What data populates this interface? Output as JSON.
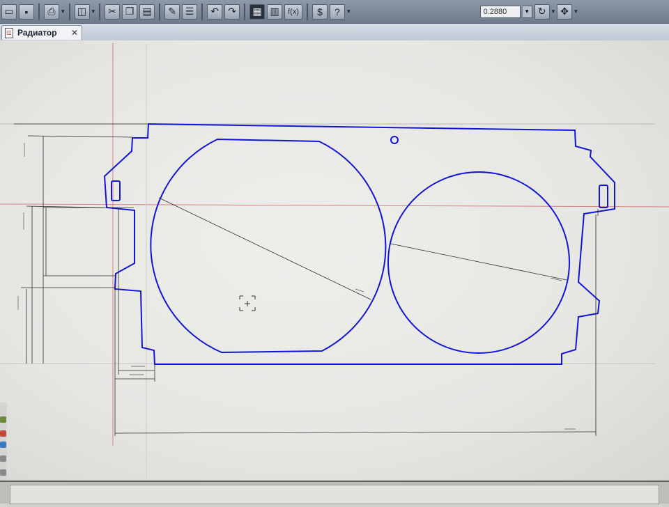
{
  "toolbar": {
    "zoom_value": "0.2880",
    "buttons": [
      {
        "icon": "new-doc-icon"
      },
      {
        "icon": "save-icon"
      },
      {
        "icon": "print-icon"
      },
      {
        "icon": "preview-icon"
      },
      {
        "icon": "cut-icon"
      },
      {
        "icon": "copy-icon"
      },
      {
        "icon": "paste-icon"
      },
      {
        "icon": "brush-icon"
      },
      {
        "icon": "properties-icon"
      },
      {
        "icon": "undo-icon"
      },
      {
        "icon": "redo-icon"
      },
      {
        "icon": "tree-icon"
      },
      {
        "icon": "table-icon"
      },
      {
        "icon": "function-icon"
      },
      {
        "icon": "variables-icon"
      },
      {
        "icon": "help-icon"
      }
    ],
    "function_glyph": "f(x)",
    "help_glyph": "?"
  },
  "tabs": [
    {
      "label": "Радиатор",
      "close": "✕"
    }
  ],
  "colors": {
    "outline": "#1414d8",
    "dimension": "#2a2a2a",
    "axis": "#d98080"
  }
}
